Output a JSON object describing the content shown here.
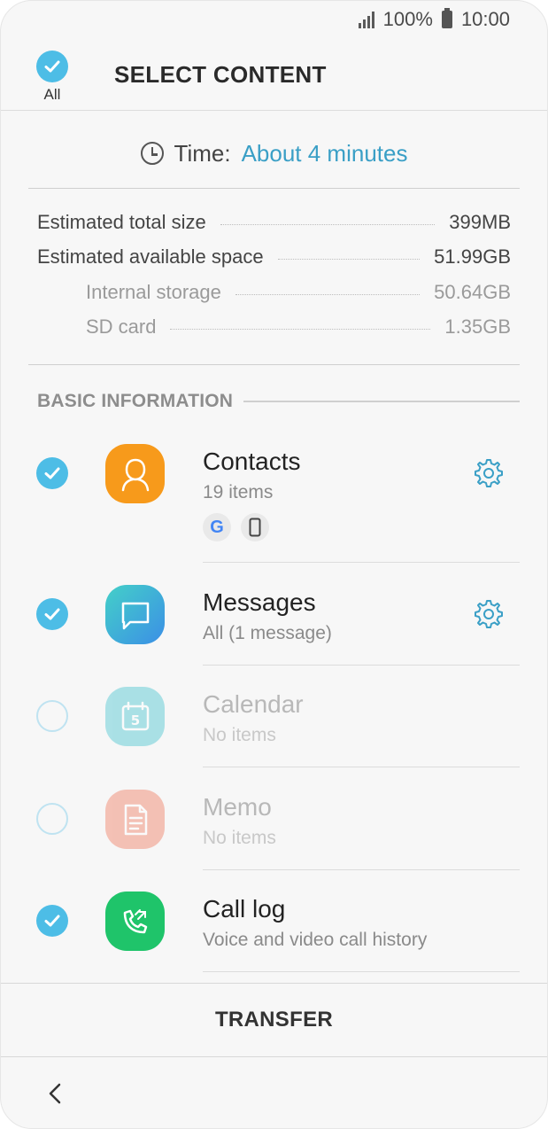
{
  "status_bar": {
    "battery": "100%",
    "time": "10:00"
  },
  "header": {
    "all_label": "All",
    "title": "SELECT CONTENT"
  },
  "time_row": {
    "label": "Time:",
    "value": "About 4 minutes"
  },
  "sizes": [
    {
      "label": "Estimated total size",
      "value": "399MB"
    },
    {
      "label": "Estimated available space",
      "value": "51.99GB"
    },
    {
      "label": "Internal storage",
      "value": "50.64GB"
    },
    {
      "label": "SD card",
      "value": "1.35GB"
    }
  ],
  "section": {
    "title": "BASIC INFORMATION"
  },
  "items": [
    {
      "title": "Contacts",
      "sub": "19 items",
      "checked": true,
      "icon": "contacts-icon",
      "color": "#f79a1b"
    },
    {
      "title": "Messages",
      "sub": "All (1 message)",
      "checked": true,
      "icon": "messages-icon",
      "color": "#3fa8e0"
    },
    {
      "title": "Calendar",
      "sub": "No items",
      "checked": false,
      "icon": "calendar-icon",
      "color": "#4dc6d0"
    },
    {
      "title": "Memo",
      "sub": "No items",
      "checked": false,
      "icon": "memo-icon",
      "color": "#f07f64"
    },
    {
      "title": "Call log",
      "sub": "Voice and video call history",
      "checked": true,
      "icon": "call-log-icon",
      "color": "#1fc46a"
    }
  ],
  "contacts_sources": {
    "google": "G"
  },
  "bottom": {
    "transfer_label": "TRANSFER"
  },
  "colors": {
    "accent": "#4dbde6",
    "link": "#3a9fc6"
  }
}
